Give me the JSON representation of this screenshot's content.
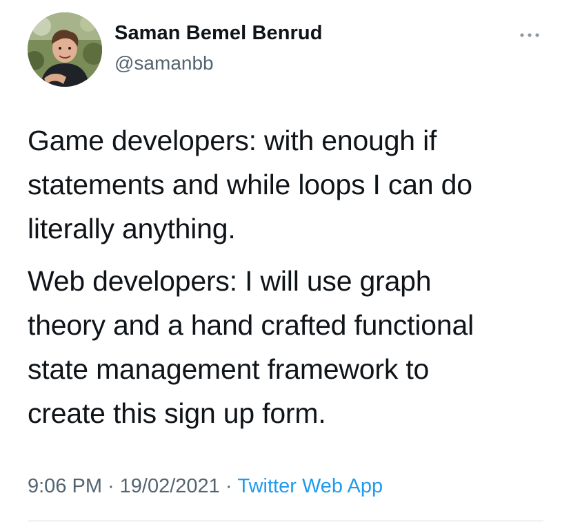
{
  "author": {
    "name": "Saman Bemel Benrud",
    "handle": "@samanbb",
    "avatar_icon": "profile-photo"
  },
  "more_icon": "more-dots-icon",
  "tweet": {
    "paragraphs": [
      "Game developers: with enough if\nstatements and while loops I can do\nliterally anything.",
      "Web developers: I will use graph\ntheory and a hand crafted functional\nstate management framework to\ncreate this sign up form."
    ]
  },
  "meta": {
    "time": "9:06 PM",
    "separator": "·",
    "date": "19/02/2021",
    "source": "Twitter Web App"
  },
  "colors": {
    "text": "#0f1419",
    "secondary": "#536471",
    "link": "#1d9bf0"
  }
}
